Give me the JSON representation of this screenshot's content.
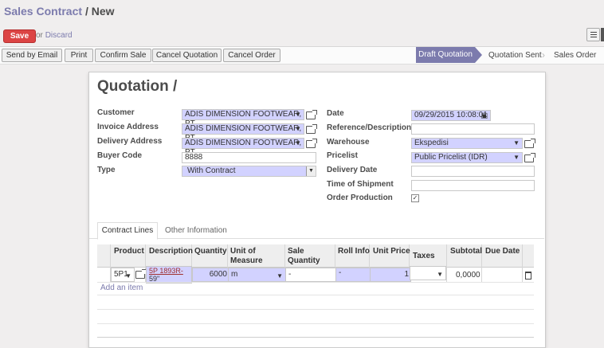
{
  "breadcrumb": {
    "parent": "Sales Contract",
    "separator": "/",
    "current": "New"
  },
  "actions": {
    "save": "Save",
    "or": "or",
    "discard": "Discard"
  },
  "toolbar": {
    "send_email": "Send by Email",
    "print": "Print",
    "confirm_sale": "Confirm Sale",
    "cancel_quotation": "Cancel Quotation",
    "cancel_order": "Cancel Order"
  },
  "stages": {
    "active": "Draft Quotation",
    "sent": "Quotation Sent",
    "order": "Sales Order"
  },
  "form": {
    "title": "Quotation /",
    "left": {
      "customer": {
        "label": "Customer",
        "value": "ADIS DIMENSION FOOTWEAR, PT"
      },
      "invoice_address": {
        "label": "Invoice Address",
        "value": "ADIS DIMENSION FOOTWEAR, PT"
      },
      "delivery_address": {
        "label": "Delivery Address",
        "value": "ADIS DIMENSION FOOTWEAR, PT"
      },
      "buyer_code": {
        "label": "Buyer Code",
        "value": "8888"
      },
      "type": {
        "label": "Type",
        "value": "With Contract"
      }
    },
    "right": {
      "date": {
        "label": "Date",
        "value": "09/29/2015 10:08:01"
      },
      "reference": {
        "label": "Reference/Description",
        "value": ""
      },
      "warehouse": {
        "label": "Warehouse",
        "value": "Ekspedisi"
      },
      "pricelist": {
        "label": "Pricelist",
        "value": "Public Pricelist (IDR)"
      },
      "delivery_date": {
        "label": "Delivery Date",
        "value": ""
      },
      "time_of_shipment": {
        "label": "Time of Shipment",
        "value": ""
      },
      "order_production": {
        "label": "Order Production",
        "checked": "✓"
      }
    }
  },
  "tabs": {
    "contract_lines": "Contract Lines",
    "other_info": "Other Information"
  },
  "table": {
    "headers": {
      "product": "Product",
      "description": "Description",
      "quantity": "Quantity",
      "uom_1": "Unit of",
      "uom_2": "Measure",
      "sale_qty_1": "Sale",
      "sale_qty_2": "Quantity",
      "roll_info": "Roll Info",
      "unit_price": "Unit Price",
      "taxes": "Taxes",
      "subtotal": "Subtotal",
      "due_date": "Due Date"
    },
    "row": {
      "product": "5P1",
      "description_1": "5P 1893R-",
      "description_2": "59\"",
      "quantity": "6000",
      "uom": "m",
      "sale_quantity": "-",
      "roll_info": "-",
      "unit_price": "1",
      "taxes": "",
      "subtotal": "0,0000",
      "due_date": ""
    },
    "add_item": "Add an item"
  }
}
